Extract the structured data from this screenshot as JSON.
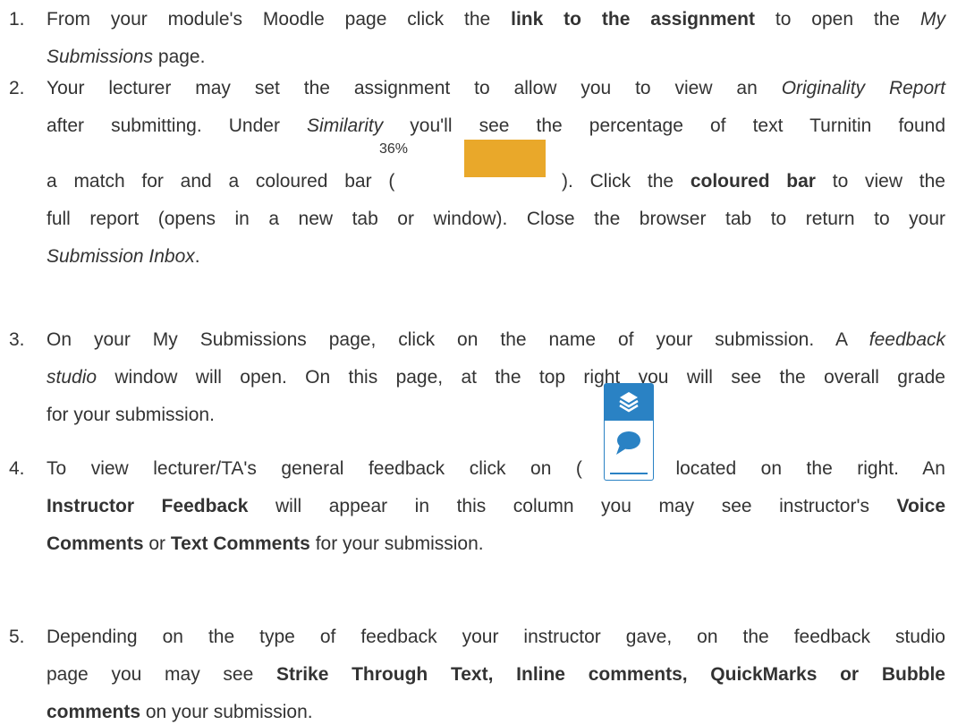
{
  "steps": [
    {
      "number": "1.",
      "lines": [
        [
          {
            "t": "From your module's Moodle page click the "
          },
          {
            "t": "link to the assignment",
            "b": true
          },
          {
            "t": " to open the "
          },
          {
            "t": "My",
            "i": true
          }
        ],
        [
          {
            "t": "Submissions",
            "i": true
          },
          {
            "t": " page."
          }
        ]
      ]
    },
    {
      "number": "2.",
      "lines": [
        [
          {
            "t": "Your lecturer may set the assignment to allow you to view an "
          },
          {
            "t": "Originality Report",
            "i": true
          }
        ],
        [
          {
            "t": "after submitting. Under "
          },
          {
            "t": "Similarity",
            "i": true
          },
          {
            "t": " you'll see the percentage of text Turnitin found"
          }
        ],
        [
          {
            "t": "a match for and a coloured bar ("
          },
          {
            "t": "                                ",
            "gap": true
          },
          {
            "t": "). Click the "
          },
          {
            "t": "coloured bar",
            "b": true
          },
          {
            "t": " to view the"
          }
        ],
        [
          {
            "t": "full report (opens in a new tab or window). Close the browser tab to return to your"
          }
        ],
        [
          {
            "t": "Submission Inbox",
            "i": true
          },
          {
            "t": "."
          }
        ]
      ],
      "similarity_percent": "36%",
      "similarity_value": 36,
      "similarity_color": "#e9a82a"
    },
    {
      "number": "3.",
      "lines": [
        [
          {
            "t": "On your My Submissions page, click on the name of your submission. A "
          },
          {
            "t": "feedback",
            "i": true
          }
        ],
        [
          {
            "t": "studio",
            "i": true
          },
          {
            "t": " window will open. On this page, at the top right you will see the overall grade"
          }
        ],
        [
          {
            "t": "for your submission."
          }
        ]
      ]
    },
    {
      "number": "4.",
      "lines": [
        [
          {
            "t": "To view lecturer/TA's general feedback click on ("
          },
          {
            "t": "            ",
            "gap": true
          },
          {
            "t": ") located on the right. An"
          }
        ],
        [
          {
            "t": "Instructor Feedback",
            "b": true
          },
          {
            "t": " will appear in this column you may see instructor's "
          },
          {
            "t": "Voice",
            "b": true
          }
        ],
        [
          {
            "t": "Comments",
            "b": true
          },
          {
            "t": " or "
          },
          {
            "t": "Text Comments",
            "b": true
          },
          {
            "t": " for your submission."
          }
        ]
      ],
      "icon": {
        "top": "layers-icon",
        "bottom": "speech-bubble-icon",
        "color": "#2a82c4"
      }
    },
    {
      "number": "5.",
      "lines": [
        [
          {
            "t": "Depending on the type of feedback your instructor gave, on the feedback studio"
          }
        ],
        [
          {
            "t": "page you may see "
          },
          {
            "t": "Strike Through Text, Inline comments, QuickMarks or Bubble",
            "b": true
          }
        ],
        [
          {
            "t": "comments",
            "b": true
          },
          {
            "t": " on your submission."
          }
        ]
      ]
    }
  ]
}
